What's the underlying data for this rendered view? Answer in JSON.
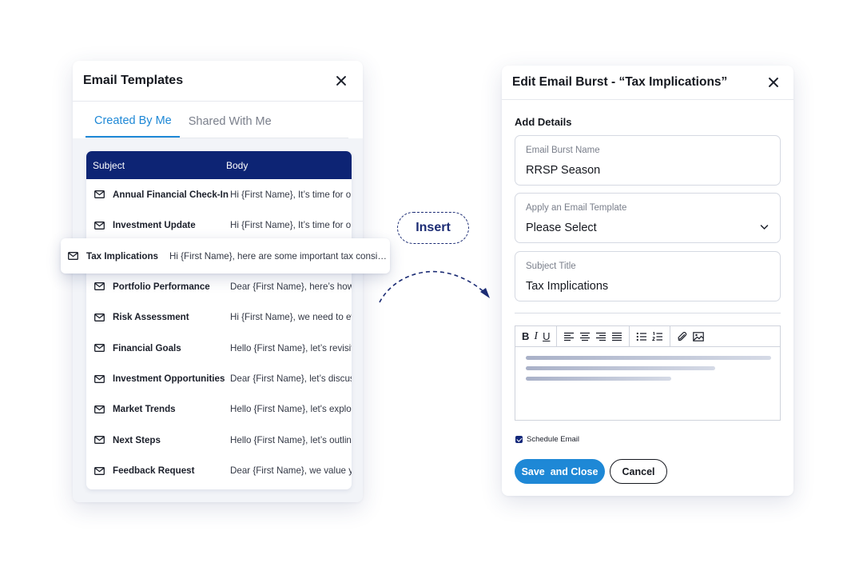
{
  "templates_panel": {
    "title": "Email Templates",
    "tabs": [
      {
        "label": "Created By Me",
        "active": true
      },
      {
        "label": "Shared With Me",
        "active": false
      }
    ],
    "columns": {
      "subject": "Subject",
      "body": "Body"
    },
    "rows": [
      {
        "subject": "Annual Financial Check-In",
        "body": "Hi {First Name}, It’s time for our"
      },
      {
        "subject": "Investment Update",
        "body": "Hi {First Name}, It’s time for our"
      },
      {
        "subject": "Tax Implications",
        "body": "Hi {First Name}, here are some important tax consid…"
      },
      {
        "subject": "Portfolio Performance",
        "body": "Dear {First Name}, here’s how your"
      },
      {
        "subject": "Risk Assessment",
        "body": "Hi {First Name}, we need to evaluate"
      },
      {
        "subject": "Financial Goals",
        "body": "Hello {First Name}, let’s revisit your"
      },
      {
        "subject": "Investment Opportunities",
        "body": "Dear {First Name}, let’s discuss"
      },
      {
        "subject": "Market Trends",
        "body": "Hello {First Name}, let's explore"
      },
      {
        "subject": "Next Steps",
        "body": "Hello {First Name}, let’s outline"
      },
      {
        "subject": "Feedback Request",
        "body": "Dear {First Name}, we value your"
      }
    ],
    "row_icon": "mail-icon",
    "close_icon": "close-icon"
  },
  "insert_label": "Insert",
  "edit_panel": {
    "title": "Edit Email Burst - “Tax Implications”",
    "section_label": "Add Details",
    "fields": {
      "burst_name": {
        "label": "Email Burst Name",
        "value": "RRSP Season"
      },
      "template": {
        "label": "Apply an Email Template",
        "value": "Please Select"
      },
      "subject": {
        "label": "Subject Title",
        "value": "Tax Implications"
      }
    },
    "toolbar": {
      "bold": "B",
      "italic": "I",
      "underline": "U"
    },
    "schedule_label": "Schedule Email",
    "schedule_checked": true,
    "save_label": "Save  and Close",
    "cancel_label": "Cancel"
  },
  "colors": {
    "table_header": "#0d2474",
    "accent_blue": "#1e88d6",
    "navy": "#1c2c74"
  }
}
